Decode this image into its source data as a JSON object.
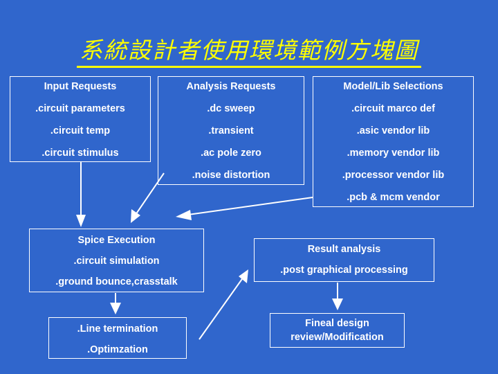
{
  "title": "系統設計者使用環境範例方塊圖",
  "colors": {
    "background": "#3066cc",
    "title": "#ffff00",
    "text": "#ffffff",
    "border": "#ffffff"
  },
  "boxes": {
    "input_requests": {
      "header": "Input Requests",
      "items": [
        ".circuit parameters",
        ".circuit temp",
        ".circuit stimulus"
      ]
    },
    "analysis_requests": {
      "header": "Analysis Requests",
      "items": [
        ".dc sweep",
        ".transient",
        ".ac pole zero",
        ".noise distortion"
      ]
    },
    "model_lib_selections": {
      "header": "Model/Lib Selections",
      "items": [
        ".circuit marco def",
        ".asic vendor lib",
        ".memory vendor lib",
        ".processor vendor lib",
        ".pcb & mcm vendor"
      ]
    },
    "spice_execution": {
      "header": "Spice Execution",
      "items": [
        ".circuit simulation",
        ".ground bounce,crasstalk"
      ]
    },
    "line_termination": {
      "header": ".Line termination",
      "items": [
        ".Optimzation"
      ]
    },
    "result_analysis": {
      "header": "Result analysis",
      "items": [
        ".post graphical processing"
      ]
    },
    "final_design": {
      "line1": "Fineal design",
      "line2": "review/Modification"
    }
  },
  "arrows": [
    {
      "name": "input-to-spice",
      "from": "input_requests",
      "to": "spice_execution",
      "direction": "down"
    },
    {
      "name": "analysis-to-spice",
      "from": "analysis_requests",
      "to": "spice_execution",
      "direction": "down-left"
    },
    {
      "name": "model-to-spice",
      "from": "model_lib_selections",
      "to": "spice_execution",
      "direction": "left"
    },
    {
      "name": "spice-to-line-termination",
      "from": "spice_execution",
      "to": "line_termination",
      "direction": "down"
    },
    {
      "name": "line-termination-to-result",
      "from": "line_termination",
      "to": "result_analysis",
      "direction": "up-right"
    },
    {
      "name": "result-to-final-design",
      "from": "result_analysis",
      "to": "final_design",
      "direction": "down"
    }
  ]
}
